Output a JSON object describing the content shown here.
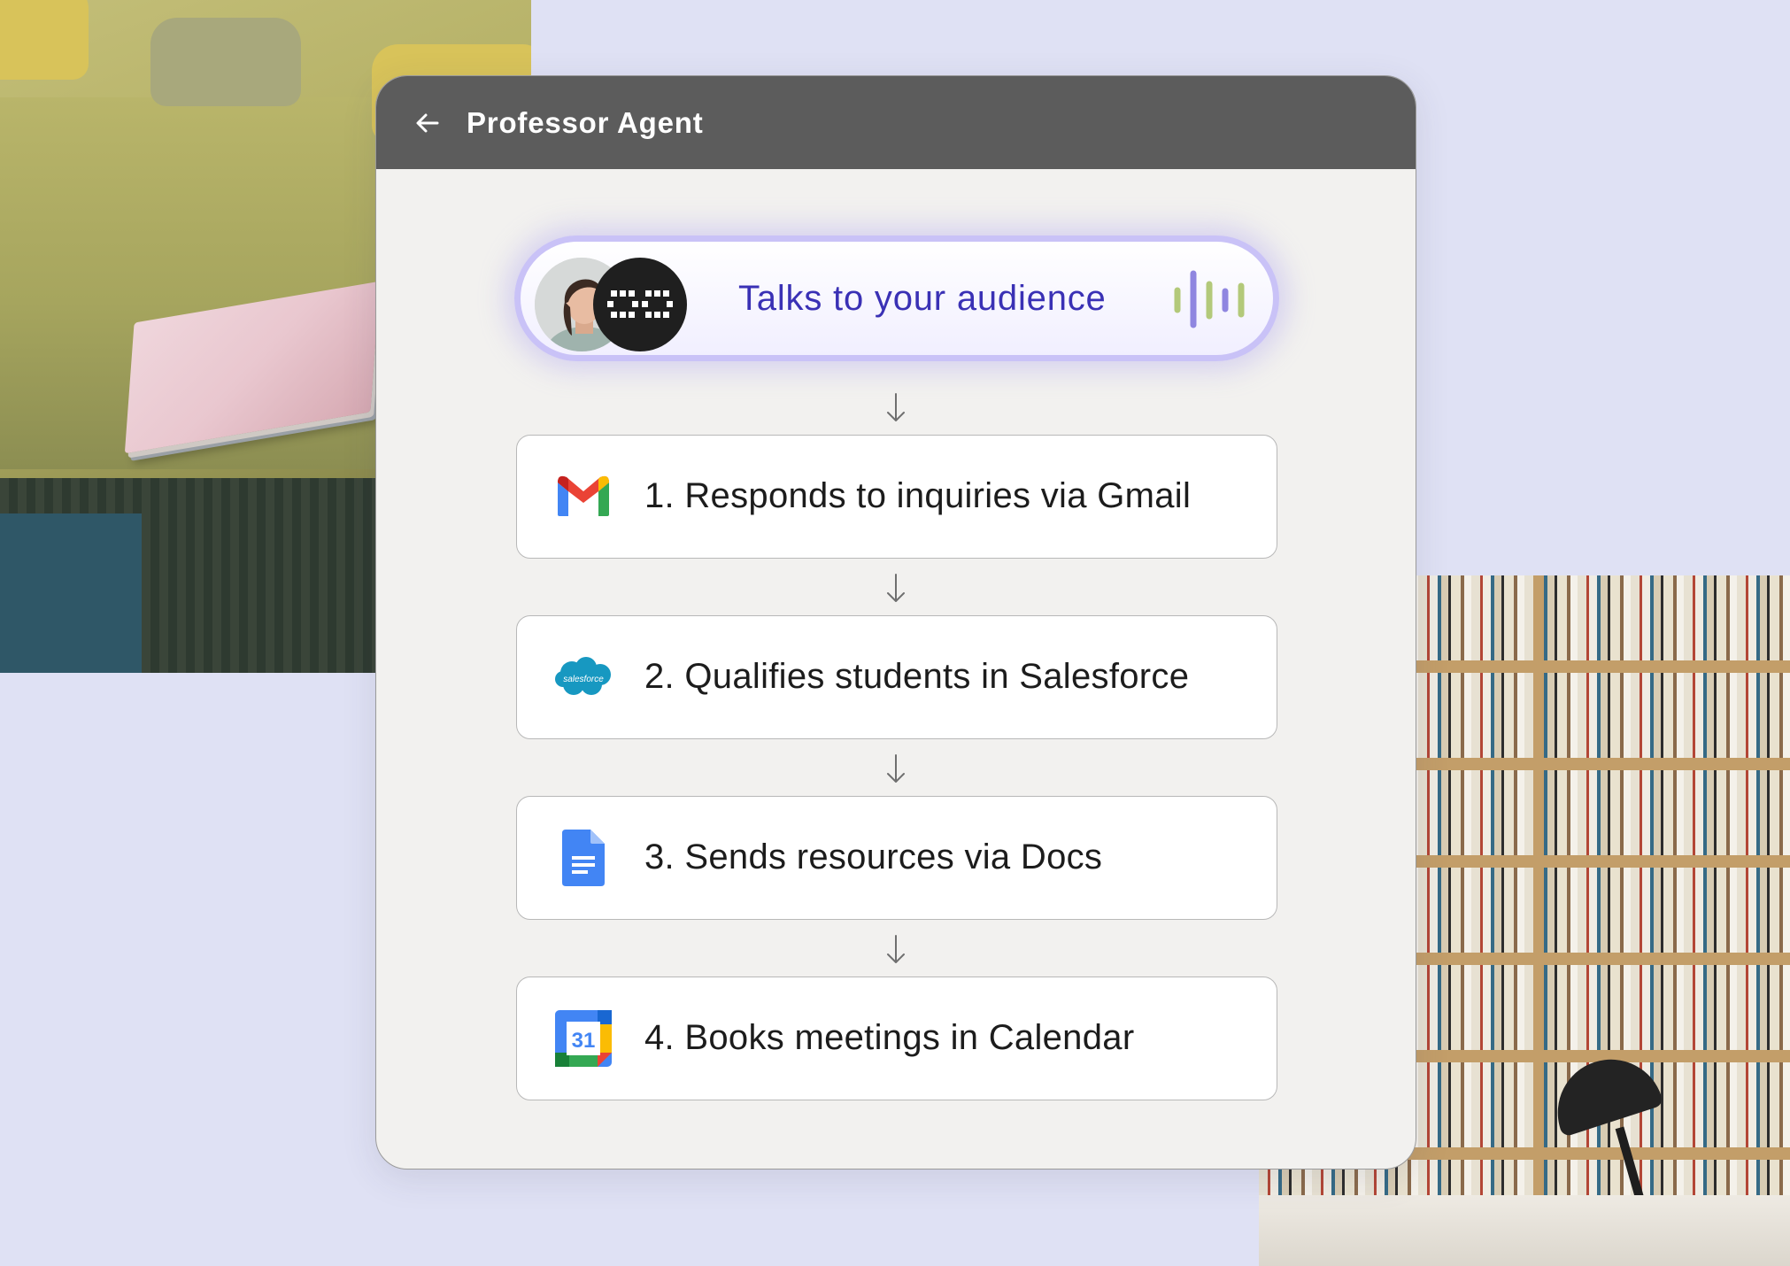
{
  "window": {
    "title": "Professor Agent"
  },
  "trigger": {
    "label": "Talks to your audience"
  },
  "steps": [
    {
      "label": "1. Responds to inquiries via Gmail",
      "icon": "gmail-icon"
    },
    {
      "label": "2. Qualifies students in Salesforce",
      "icon": "salesforce-icon",
      "logo_text": "salesforce"
    },
    {
      "label": "3. Sends resources via Docs",
      "icon": "google-docs-icon"
    },
    {
      "label": "4. Books meetings in Calendar",
      "icon": "google-calendar-icon",
      "logo_text": "31"
    }
  ],
  "colors": {
    "page_background": "#dfe1f4",
    "card_background": "#f2f1ef",
    "header_background": "#5c5c5c",
    "trigger_text": "#3a31b5",
    "trigger_border": "#c9c2f7"
  }
}
